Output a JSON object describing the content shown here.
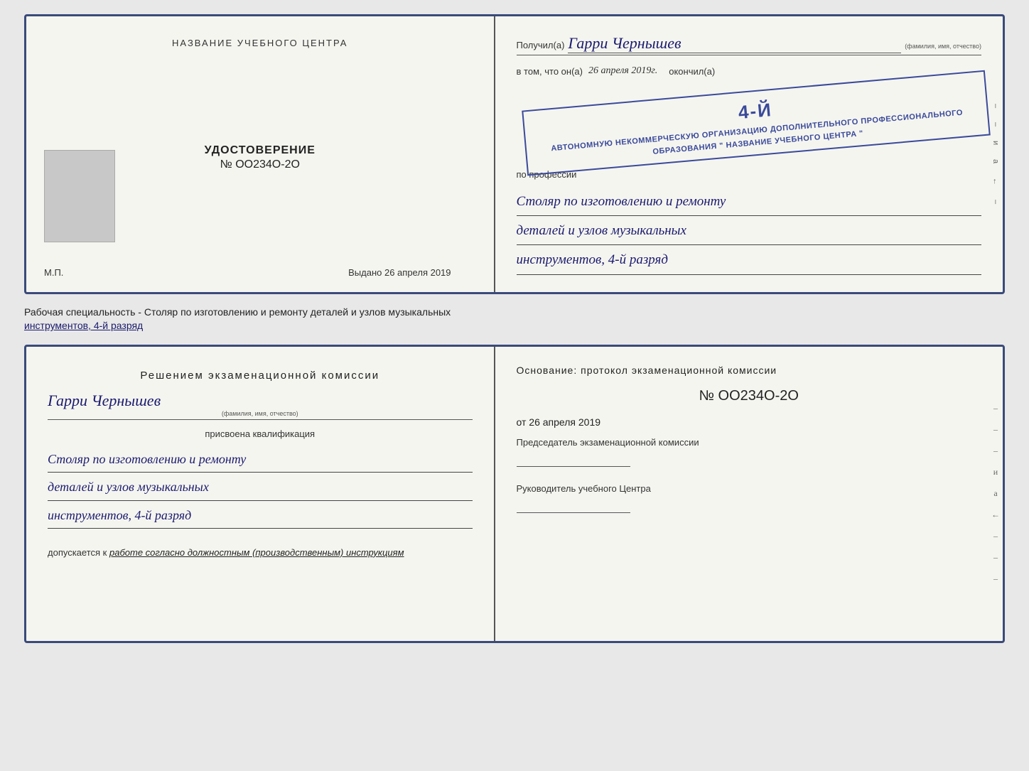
{
  "top_left": {
    "center_title": "НАЗВАНИЕ УЧЕБНОГО ЦЕНТРА",
    "udostoverenie_label": "УДОСТОВЕРЕНИЕ",
    "number": "№ OO234O-2O",
    "vydano_label": "Выдано",
    "vydano_date": "26 апреля 2019",
    "mp_label": "М.П."
  },
  "top_right": {
    "poluchil_label": "Получил(а)",
    "name": "Гарри Чернышев",
    "fio_note": "(фамилия, имя, отчество)",
    "vtom_prefix": "в том, что он(а)",
    "vtom_date": "26 апреля 2019г.",
    "okonchil": "окончил(а)",
    "stamp_line1": "АВТОНОМНУЮ НЕКОММЕРЧЕСКУЮ ОРГАНИЗАЦИЮ",
    "stamp_line2": "ДОПОЛНИТЕЛЬНОГО ПРОФЕССИОНАЛЬНОГО ОБРАЗОВАНИЯ",
    "stamp_line3": "\" НАЗВАНИЕ УЧЕБНОГО ЦЕНТРА \"",
    "stamp_digit": "4-й",
    "po_professii": "по профессии",
    "profession_line1": "Столяр по изготовлению и ремонту",
    "profession_line2": "деталей и узлов музыкальных",
    "profession_line3": "инструментов, 4-й разряд"
  },
  "middle_label": {
    "text": "Рабочая специальность - Столяр по изготовлению и ремонту деталей и узлов музыкальных",
    "text2": "инструментов, 4-й разряд"
  },
  "bottom_left": {
    "reshenie_title": "Решением  экзаменационной  комиссии",
    "name": "Гарри Чернышев",
    "fio_note": "(фамилия, имя, отчество)",
    "prisvoyena": "присвоена квалификация",
    "profession_line1": "Столяр по изготовлению и ремонту",
    "profession_line2": "деталей и узлов музыкальных",
    "profession_line3": "инструментов, 4-й разряд",
    "dopuskaetsya_label": "допускается к",
    "dopuskaetsya_text": "работе согласно должностным (производственным) инструкциям"
  },
  "bottom_right": {
    "osnovanie_label": "Основание: протокол экзаменационной  комиссии",
    "number": "№  OO234O-2O",
    "ot_prefix": "от",
    "ot_date": "26 апреля 2019",
    "predsedatel_label": "Председатель экзаменационной комиссии",
    "rukovoditel_label": "Руководитель учебного Центра"
  },
  "side_chars": {
    "top": [
      "–",
      "–",
      "–",
      "и",
      "а",
      "←",
      "–"
    ],
    "bottom": [
      "–",
      "–",
      "–",
      "и",
      "а",
      "←",
      "–",
      "–",
      "–"
    ]
  }
}
